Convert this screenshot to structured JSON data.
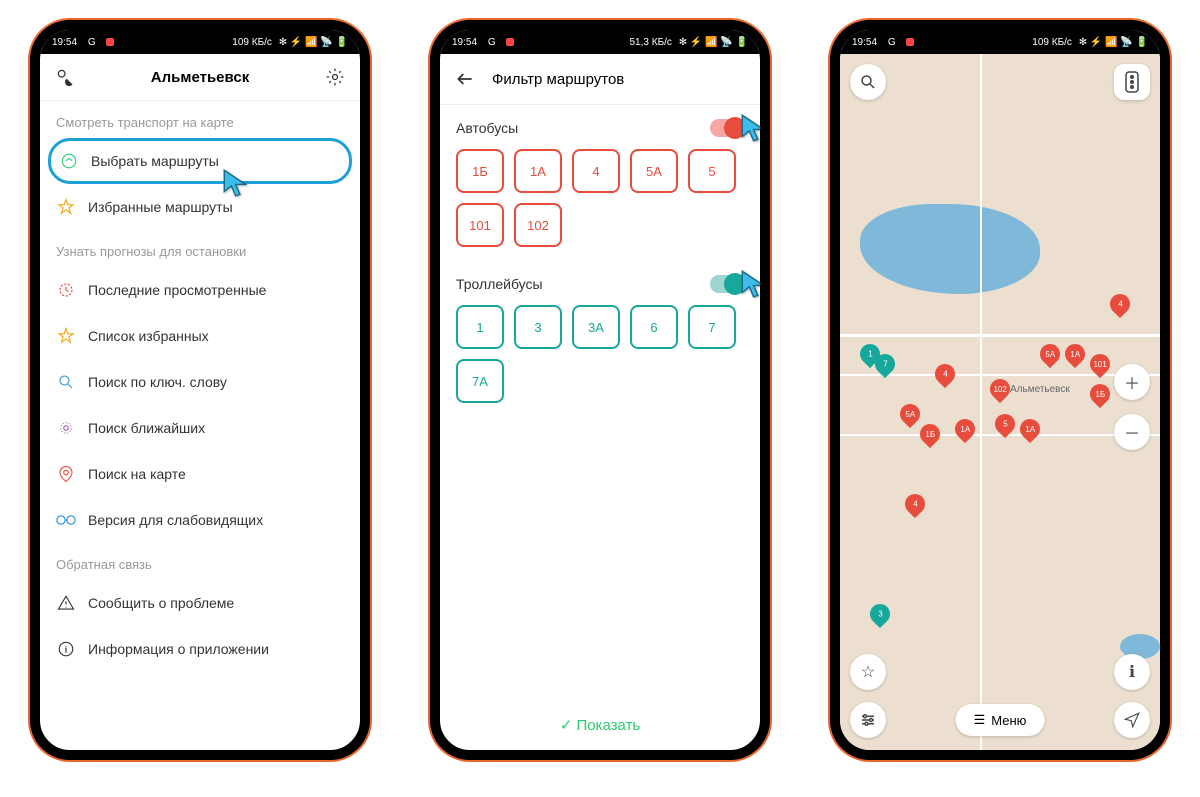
{
  "status": {
    "time": "19:54",
    "net": "G",
    "right1": "109 КБ/с",
    "right2": "51,3 КБ/с"
  },
  "phone1": {
    "title": "Альметьевск",
    "section1_label": "Смотреть транспорт на карте",
    "item_select_routes": "Выбрать маршруты",
    "item_favorite_routes": "Избранные маршруты",
    "section2_label": "Узнать прогнозы для остановки",
    "item_recent": "Последние просмотренные",
    "item_fav_list": "Список избранных",
    "item_search_keyword": "Поиск по ключ. слову",
    "item_search_nearby": "Поиск ближайших",
    "item_search_map": "Поиск на карте",
    "item_accessible": "Версия для слабовидящих",
    "section3_label": "Обратная связь",
    "item_report": "Сообщить о проблеме",
    "item_about": "Информация о приложении"
  },
  "phone2": {
    "title": "Фильтр маршрутов",
    "buses_label": "Автобусы",
    "buses": [
      "1Б",
      "1А",
      "4",
      "5А",
      "5",
      "101",
      "102"
    ],
    "trolleys_label": "Троллейбусы",
    "trolleys": [
      "1",
      "3",
      "3А",
      "6",
      "7",
      "7А"
    ],
    "show_btn": "Показать"
  },
  "phone3": {
    "city": "Альметьевск",
    "menu": "Меню"
  }
}
